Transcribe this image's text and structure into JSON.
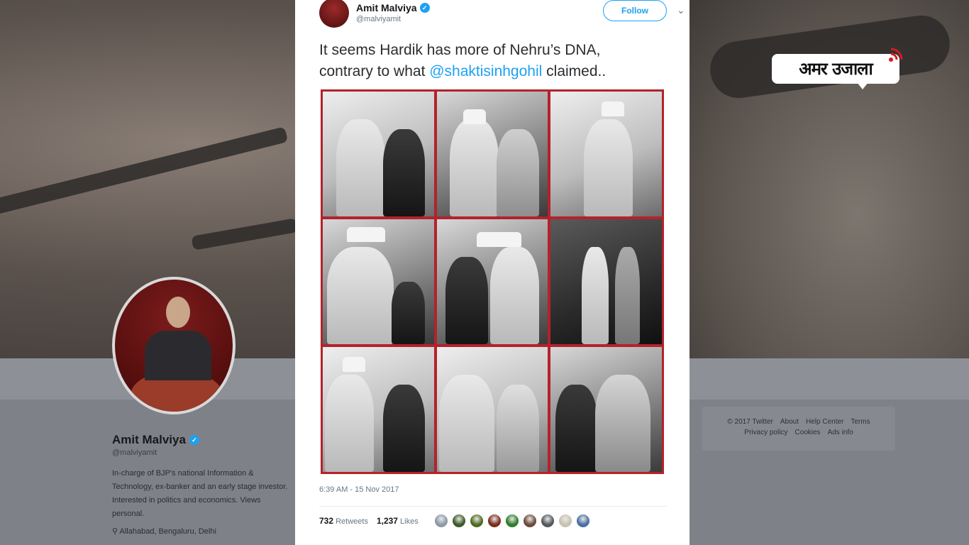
{
  "tweet": {
    "author_name": "Amit Malviya",
    "author_handle": "@malviyamit",
    "follow_label": "Follow",
    "caret": "⌄",
    "text_line1": "It seems Hardik has more of Nehru’s DNA,",
    "text_prefix": "contrary to what ",
    "mention": "@shaktisinhgohil",
    "text_suffix": " claimed..",
    "timestamp": "6:39 AM - 15 Nov 2017",
    "retweets_count": "732",
    "retweets_label": "Retweets",
    "likes_count": "1,237",
    "likes_label": "Likes",
    "liker_colors": [
      "#8c9aa6",
      "#3f5a2a",
      "#4f6b1f",
      "#7a2b1c",
      "#2f7d2a",
      "#6b4b3a",
      "#55585e",
      "#c7c2b0",
      "#4a6fa5"
    ]
  },
  "profile": {
    "name": "Amit Malviya",
    "handle": "@malviyamit",
    "bio": "In-charge of BJP's national Information & Technology, ex-banker and an early stage investor. Interested in politics and economics. Views personal.",
    "location": "Allahabad, Bengaluru, Delhi"
  },
  "footer": {
    "links": [
      "© 2017 Twitter",
      "About",
      "Help Center",
      "Terms",
      "Privacy policy",
      "Cookies",
      "Ads info"
    ]
  },
  "logo": {
    "text": "अमर उजाला"
  }
}
